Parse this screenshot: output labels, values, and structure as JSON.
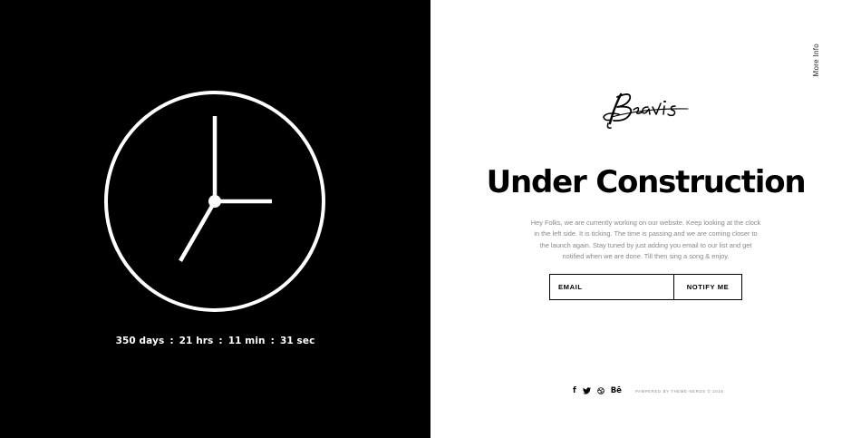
{
  "countdown": {
    "days": "350 days",
    "hours": "21 hrs",
    "minutes": "11 min",
    "seconds": "31 sec",
    "separator": ":"
  },
  "clock": {
    "hour": 7,
    "minute": 0,
    "second": 15
  },
  "header": {
    "more_info": "More Info",
    "logo_text": "Beavis"
  },
  "main": {
    "title": "Under Construction",
    "intro": "Hey Folks, we are currently working on our website. Keep looking at the clock in the left side. It is ticking. The time is passing and we are coming closer to the launch again. Stay tuned by just adding you email to our list and get notified when we are done. Till then sing a song & enjoy."
  },
  "form": {
    "email_placeholder": "EMAIL",
    "notify_label": "NOTIFY ME"
  },
  "footer": {
    "social": {
      "facebook": "f",
      "behance": "Bē"
    },
    "copyright": "PAMPERED BY THEME-NERDS © 2016"
  },
  "colors": {
    "left_background": "#000000",
    "right_background": "#ffffff",
    "text_muted": "#888888"
  }
}
